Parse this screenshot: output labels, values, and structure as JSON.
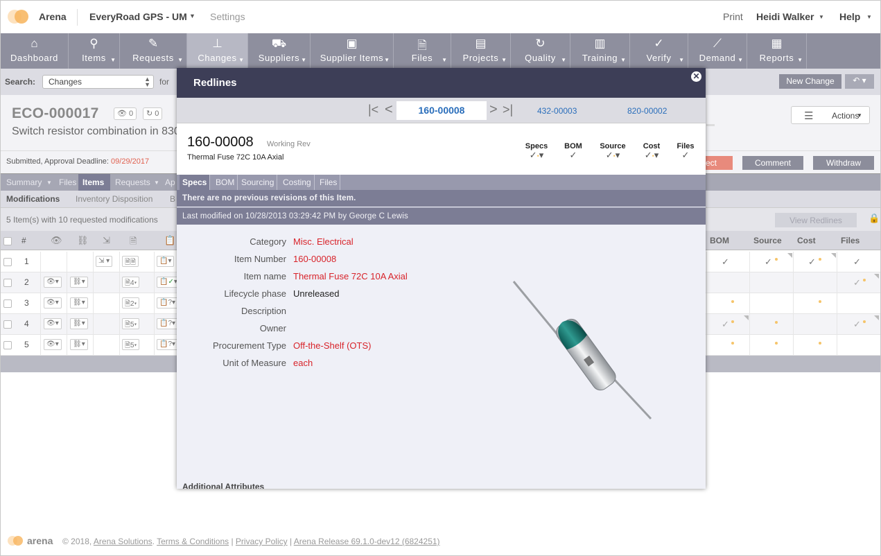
{
  "topbar": {
    "brand": "Arena",
    "workspace": "EveryRoad GPS - UM",
    "settings": "Settings",
    "print": "Print",
    "user": "Heidi Walker",
    "help": "Help",
    "colors": {
      "logo_light": "#fde2bf",
      "logo_dark": "#f7b45c"
    }
  },
  "nav": [
    {
      "label": "Dashboard",
      "icon": "home-icon",
      "caret": false
    },
    {
      "label": "Items",
      "icon": "item-icon",
      "caret": true
    },
    {
      "label": "Requests",
      "icon": "edit-icon",
      "caret": true
    },
    {
      "label": "Changes",
      "icon": "stamp-icon",
      "caret": true
    },
    {
      "label": "Suppliers",
      "icon": "truck-icon",
      "caret": true
    },
    {
      "label": "Supplier Items",
      "icon": "box-icon",
      "caret": true
    },
    {
      "label": "Files",
      "icon": "file-icon",
      "caret": true
    },
    {
      "label": "Projects",
      "icon": "briefcase-icon",
      "caret": true
    },
    {
      "label": "Quality",
      "icon": "refresh-icon",
      "caret": true
    },
    {
      "label": "Training",
      "icon": "book-icon",
      "caret": true
    },
    {
      "label": "Verify",
      "icon": "check-icon",
      "caret": true
    },
    {
      "label": "Demand",
      "icon": "chart-line-icon",
      "caret": true
    },
    {
      "label": "Reports",
      "icon": "report-icon",
      "caret": true
    }
  ],
  "search": {
    "label": "Search:",
    "scope": "Changes",
    "for": "for",
    "new_change": "New Change"
  },
  "change": {
    "number": "ECO-000017",
    "description": "Switch resistor combination in 830",
    "watch_count": "0",
    "refresh_count": "0",
    "actions": "Actions",
    "submitted_label": "Submitted, Approval Deadline:",
    "deadline": "09/29/2017",
    "reject": "ect",
    "comment": "Comment",
    "withdraw": "Withdraw"
  },
  "tabs": {
    "summary": "Summary",
    "files": "Files",
    "items": "Items",
    "requests": "Requests",
    "ap": "Ap",
    "modifications": "Modifications",
    "inventory": "Inventory Disposition",
    "b": "B",
    "count": "5 Item(s) with 10 requested modifications",
    "view_redlines": "View Redlines"
  },
  "table": {
    "headers": {
      "num": "#",
      "bom": "BOM",
      "source": "Source",
      "cost": "Cost",
      "files": "Files"
    },
    "rows": [
      {
        "n": "1",
        "files_n": ""
      },
      {
        "n": "2",
        "files_n": "4"
      },
      {
        "n": "3",
        "files_n": "2"
      },
      {
        "n": "4",
        "files_n": "5"
      },
      {
        "n": "5",
        "files_n": "5"
      }
    ]
  },
  "footer": {
    "copyright": "© 2018,",
    "company": "Arena Solutions",
    "terms": "Terms & Conditions",
    "privacy": "Privacy Policy",
    "release": "Arena Release 69.1.0-dev12 (6824251)"
  },
  "modal": {
    "title": "Redlines",
    "current": "160-00008",
    "next1": "432-00003",
    "next2": "820-00002",
    "item_number": "160-00008",
    "rev": "Working Rev",
    "item_name": "Thermal Fuse 72C 10A Axial",
    "cols": [
      "Specs",
      "BOM",
      "Source",
      "Cost",
      "Files"
    ],
    "tabs": [
      "Specs",
      "BOM",
      "Sourcing",
      "Costing",
      "Files"
    ],
    "no_revisions": "There are no previous revisions of this Item.",
    "last_modified": "Last modified on 10/28/2013 03:29:42 PM by George C Lewis",
    "fields": [
      {
        "label": "Category",
        "value": "Misc. Electrical"
      },
      {
        "label": "Item Number",
        "value": "160-00008"
      },
      {
        "label": "Item name",
        "value": "Thermal Fuse 72C 10A Axial"
      },
      {
        "label": "Lifecycle phase",
        "value": "Unreleased"
      },
      {
        "label": "Description",
        "value": ""
      },
      {
        "label": "Owner",
        "value": ""
      },
      {
        "label": "Procurement Type",
        "value": "Off-the-Shelf (OTS)"
      },
      {
        "label": "Unit of Measure",
        "value": "each"
      }
    ],
    "additional": "Additional Attributes",
    "colors": {
      "header": "#3d3e57",
      "link": "#2a6ebb",
      "changed": "#d8232a"
    }
  }
}
